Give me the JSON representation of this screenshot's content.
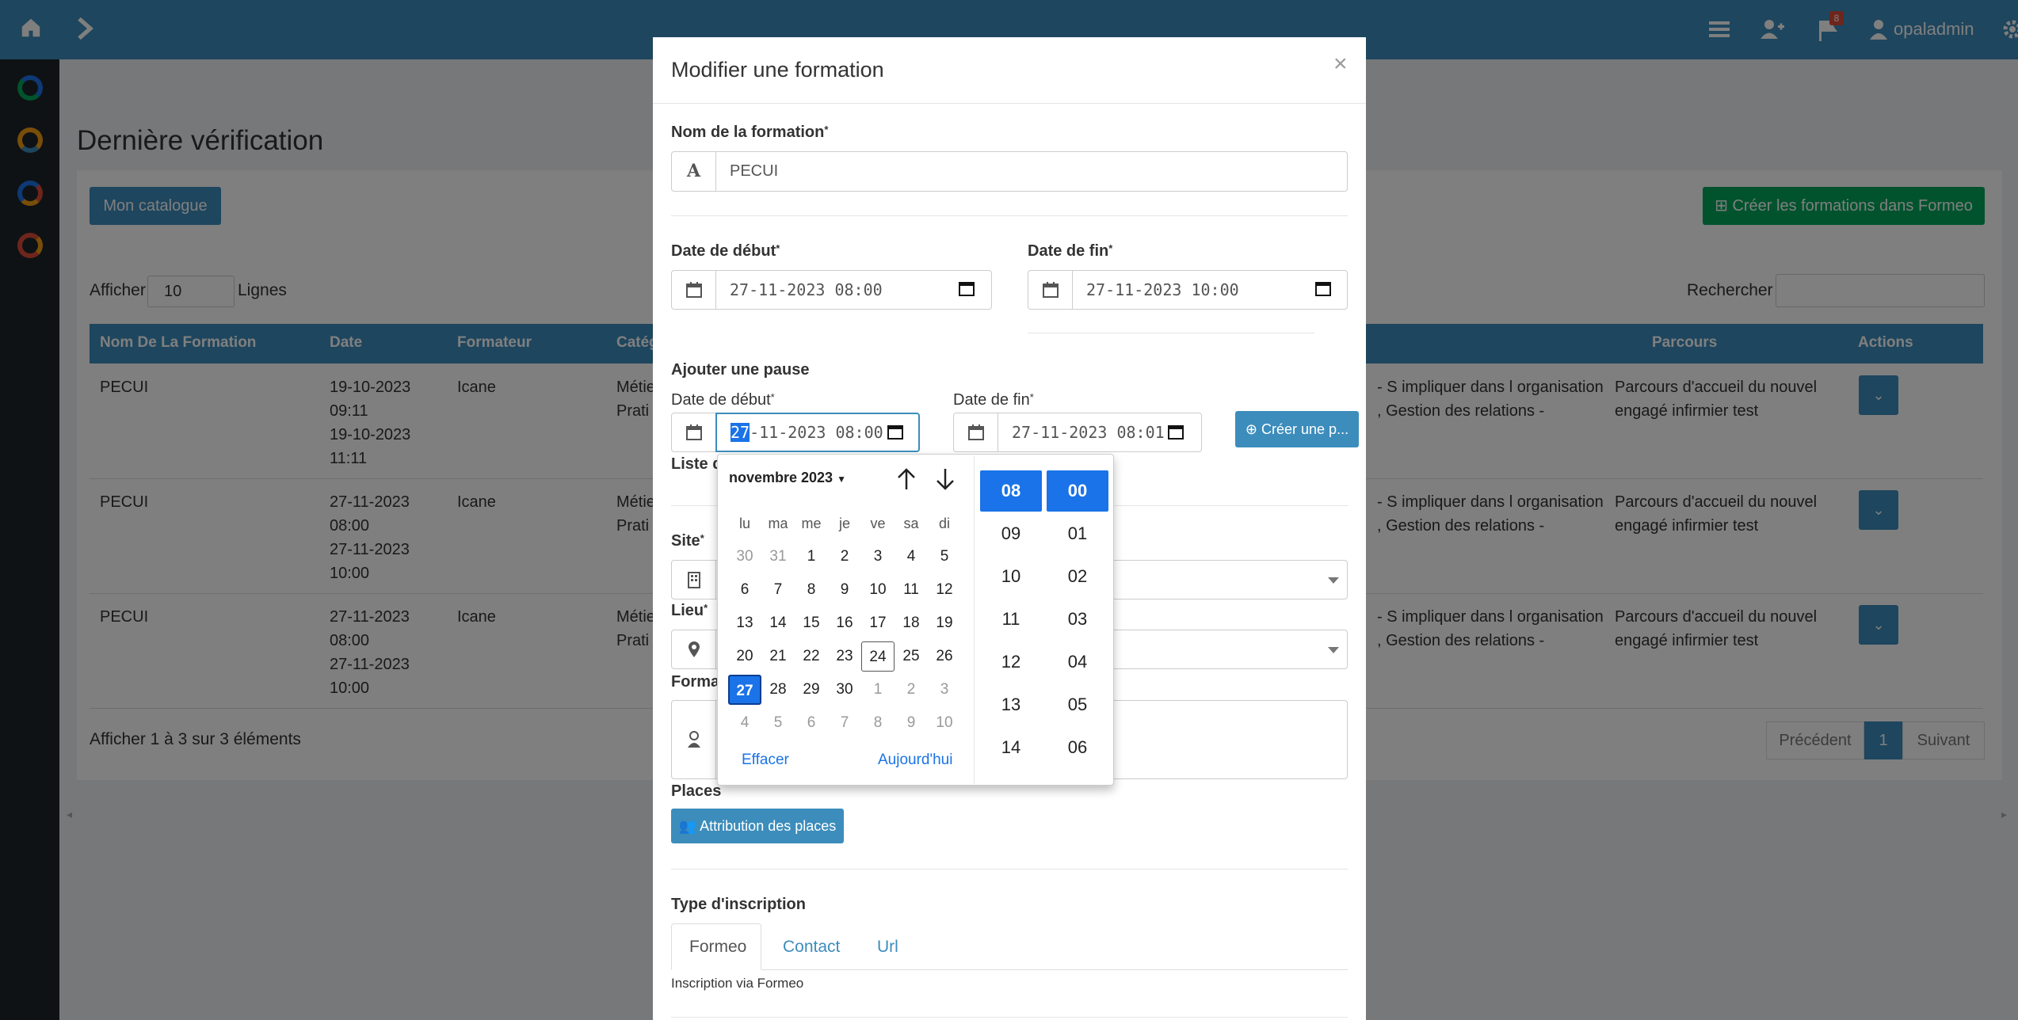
{
  "topbar": {
    "notification_count": "8",
    "user_name": "opaladmin",
    "icons": [
      "home-icon",
      "chevron-right-icon",
      "list-icon",
      "user-plus-icon",
      "flag-icon",
      "user-icon",
      "gear-icon"
    ]
  },
  "sidebar": {
    "icons": [
      "app-blue-icon",
      "app-orange-icon",
      "app-chrome-icon",
      "app-red-icon"
    ]
  },
  "background": {
    "page_title": "Dernière vérification",
    "catalog_button": "Mon catalogue",
    "create_button": "Créer les formations dans Formeo",
    "show_label": "Afficher",
    "show_value": "10",
    "rows_label": "Lignes",
    "search_label": "Rechercher",
    "table": {
      "headers": [
        "Nom De La Formation",
        "Date",
        "Formateur",
        "Catég",
        "Parcours",
        "Actions"
      ],
      "rows": [
        {
          "name": "PECUI",
          "date": [
            "19-10-2023",
            "09:11",
            "19-10-2023",
            "11:11"
          ],
          "trainer": "Icane",
          "cat": [
            "Métie",
            "Prati"
          ],
          "skills": [
            "- S impliquer dans l organisation",
            ", Gestion des relations -"
          ],
          "path": [
            "Parcours d'accueil du nouvel",
            "engagé infirmier test"
          ]
        },
        {
          "name": "PECUI",
          "date": [
            "27-11-2023",
            "08:00",
            "27-11-2023",
            "10:00"
          ],
          "trainer": "Icane",
          "cat": [
            "Métie",
            "Prati"
          ],
          "skills": [
            "- S impliquer dans l organisation",
            ", Gestion des relations -"
          ],
          "path": [
            "Parcours d'accueil du nouvel",
            "engagé infirmier test"
          ]
        },
        {
          "name": "PECUI",
          "date": [
            "27-11-2023",
            "08:00",
            "27-11-2023",
            "10:00"
          ],
          "trainer": "Icane",
          "cat": [
            "Métie",
            "Prati"
          ],
          "skills": [
            "- S impliquer dans l organisation",
            ", Gestion des relations -"
          ],
          "path": [
            "Parcours d'accueil du nouvel",
            "engagé infirmier test"
          ]
        }
      ]
    },
    "info": "Afficher 1 à 3 sur 3 éléments",
    "pagination": {
      "prev": "Précédent",
      "current": "1",
      "next": "Suivant"
    }
  },
  "modal": {
    "title": "Modifier une formation",
    "close": "×",
    "name_label": "Nom de la formation",
    "name_value": "PECUI",
    "name_icon_glyph": "A",
    "start_label": "Date de début",
    "start_value": "27-11-2023 08:00",
    "end_label": "Date de fin",
    "end_value": "27-11-2023 10:00",
    "pause_section": "Ajouter une pause",
    "pause_start_label": "Date de début",
    "pause_start_day": "27",
    "pause_start_rest": "-11-2023 08:00",
    "pause_end_label": "Date de fin",
    "pause_end_value": "27-11-2023 08:01",
    "create_pause_button": "Créer une p...",
    "list_label_partial": "Liste d",
    "site_label": "Site",
    "place_label": "Lieu",
    "trainer_label_partial": "Forma",
    "places_label": "Places",
    "places_button": "Attribution des places",
    "registration_label": "Type d'inscription",
    "tabs": [
      "Formeo",
      "Contact",
      "Url"
    ],
    "registration_note": "Inscription via Formeo",
    "required_mark": "*"
  },
  "datepicker": {
    "month_label": "novembre 2023",
    "weekdays": [
      "lu",
      "ma",
      "me",
      "je",
      "ve",
      "sa",
      "di"
    ],
    "weeks": [
      [
        "30",
        "31",
        "1",
        "2",
        "3",
        "4",
        "5"
      ],
      [
        "6",
        "7",
        "8",
        "9",
        "10",
        "11",
        "12"
      ],
      [
        "13",
        "14",
        "15",
        "16",
        "17",
        "18",
        "19"
      ],
      [
        "20",
        "21",
        "22",
        "23",
        "24",
        "25",
        "26"
      ],
      [
        "27",
        "28",
        "29",
        "30",
        "1",
        "2",
        "3"
      ],
      [
        "4",
        "5",
        "6",
        "7",
        "8",
        "9",
        "10"
      ]
    ],
    "clear": "Effacer",
    "today": "Aujourd'hui",
    "hours": [
      "08",
      "09",
      "10",
      "11",
      "12",
      "13",
      "14"
    ],
    "minutes": [
      "00",
      "01",
      "02",
      "03",
      "04",
      "05",
      "06"
    ],
    "selected_hour": "08",
    "selected_minute": "00",
    "accent": "#1a73e8"
  },
  "colors": {
    "brand": "#3c8dbc",
    "success": "#00a65a",
    "sidebar": "#1f2528"
  }
}
